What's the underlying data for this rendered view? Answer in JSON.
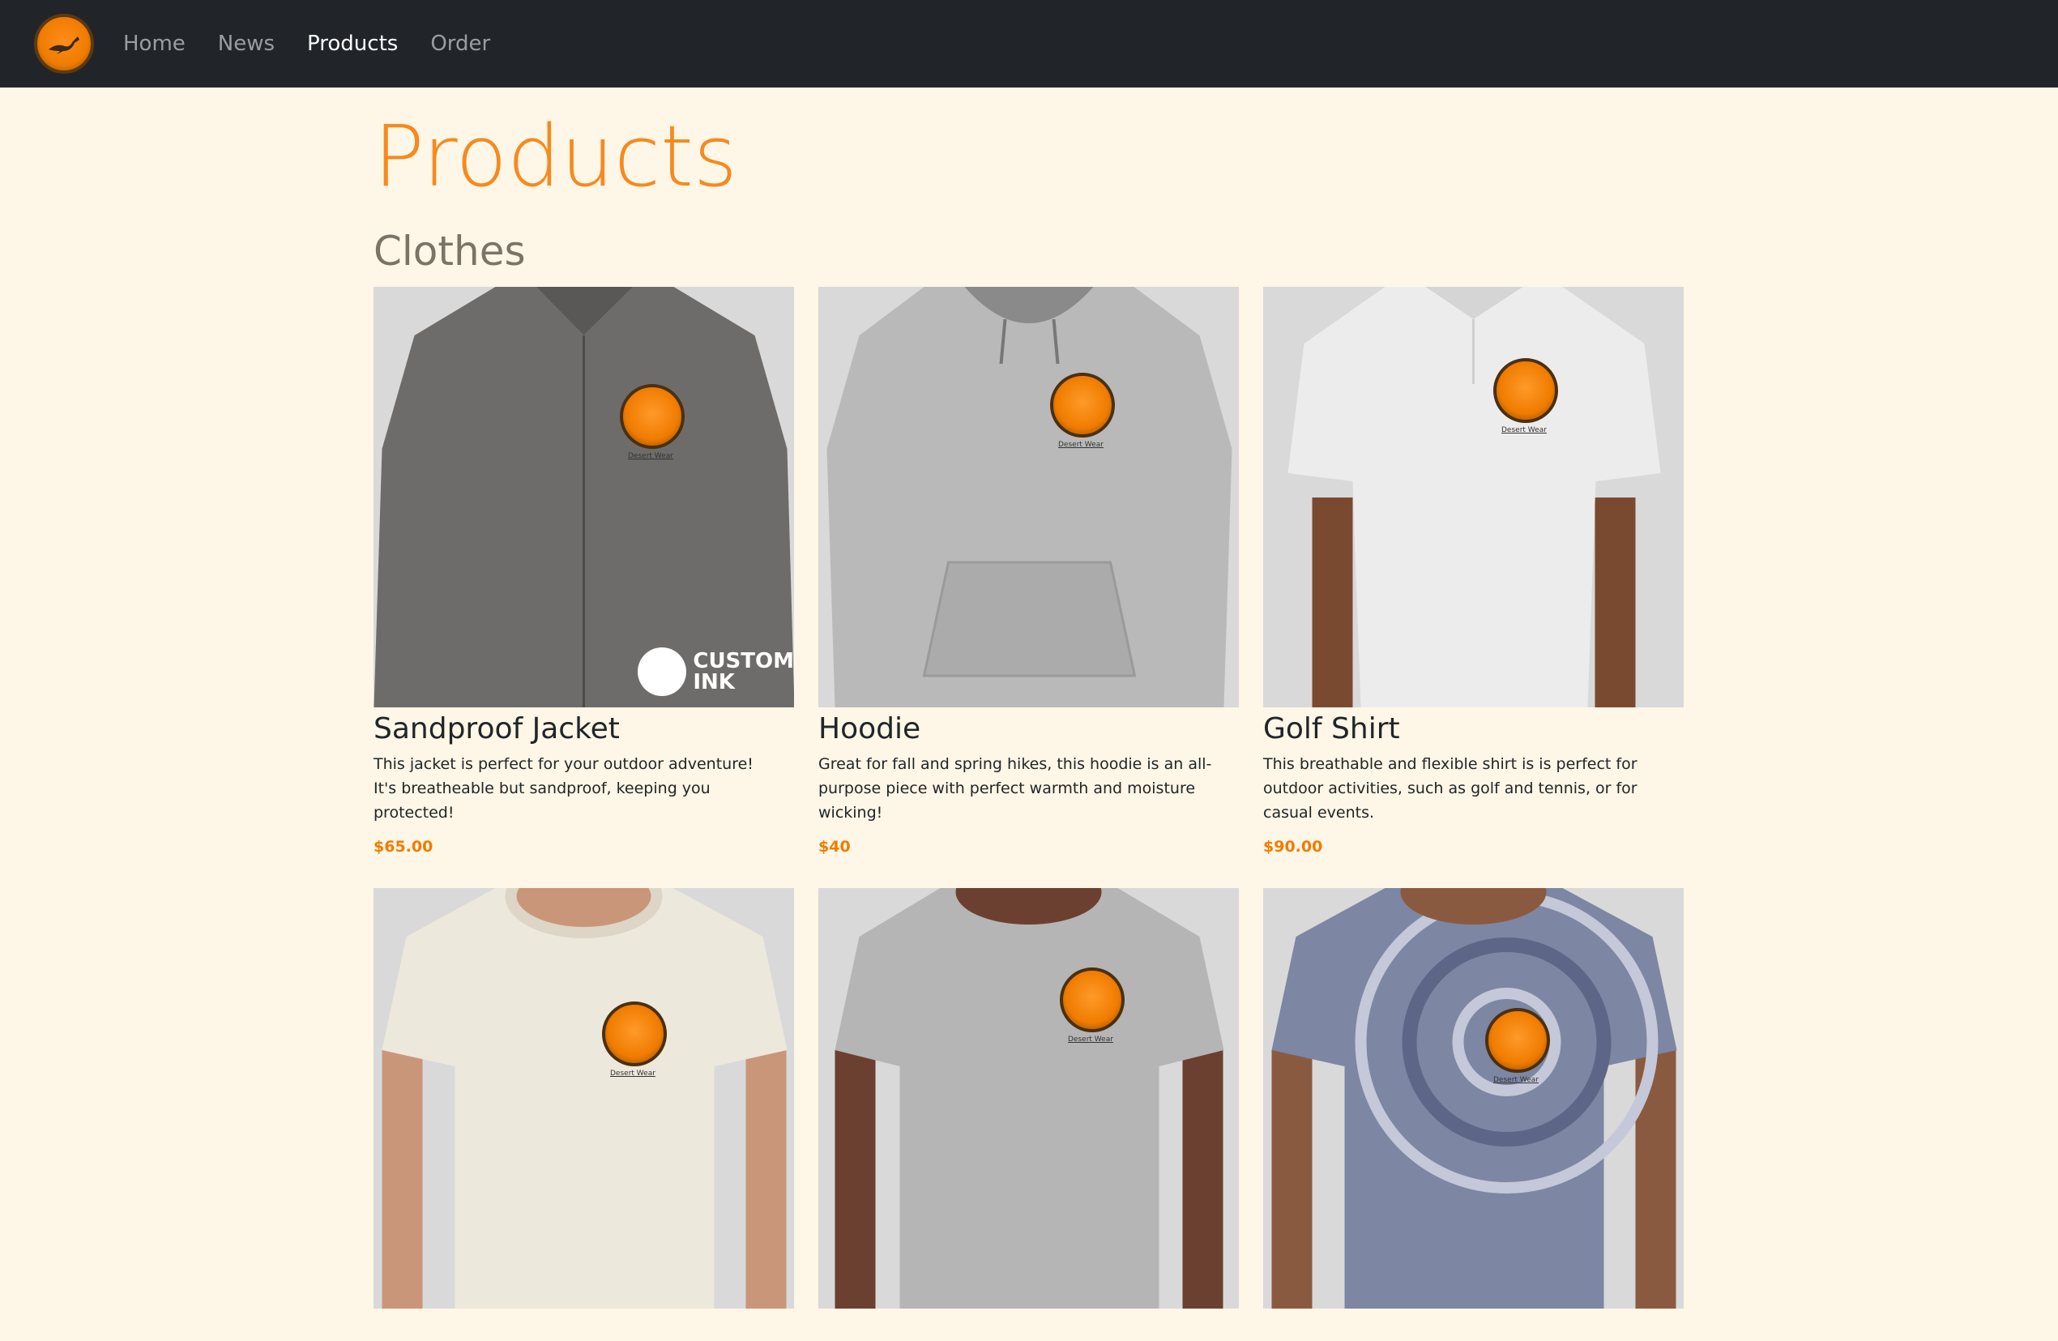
{
  "nav": {
    "items": [
      {
        "label": "Home"
      },
      {
        "label": "News"
      },
      {
        "label": "Products"
      },
      {
        "label": "Order"
      }
    ]
  },
  "page": {
    "title": "Products",
    "section": "Clothes"
  },
  "products": [
    {
      "name": "Sandproof Jacket",
      "description": "This jacket is perfect for your outdoor adventure! It's breatheable but sandproof, keeping you protected!",
      "price": "$65.00",
      "color": "#6e6c6a"
    },
    {
      "name": "Hoodie",
      "description": "Great for fall and spring hikes, this hoodie is an all-purpose piece with perfect warmth and moisture wicking!",
      "price": "$40",
      "color": "#b9b9b9"
    },
    {
      "name": "Golf Shirt",
      "description": "This breathable and flexible shirt is is perfect for outdoor activities, such as golf and tennis, or for casual events.",
      "price": "$90.00",
      "color": "#ececec"
    },
    {
      "name": "",
      "description": "",
      "price": "",
      "color": "#ede8dc"
    },
    {
      "name": "",
      "description": "",
      "price": "",
      "color": "#b5b5b5"
    },
    {
      "name": "",
      "description": "",
      "price": "",
      "color": "#7d86a3"
    }
  ],
  "badge_text": "Desert Wear",
  "watermark": {
    "line1": "CUSTOM",
    "line2": "INK"
  },
  "colors": {
    "accent": "#f58a1f",
    "navbar": "#212529",
    "background": "#fef6e6"
  }
}
